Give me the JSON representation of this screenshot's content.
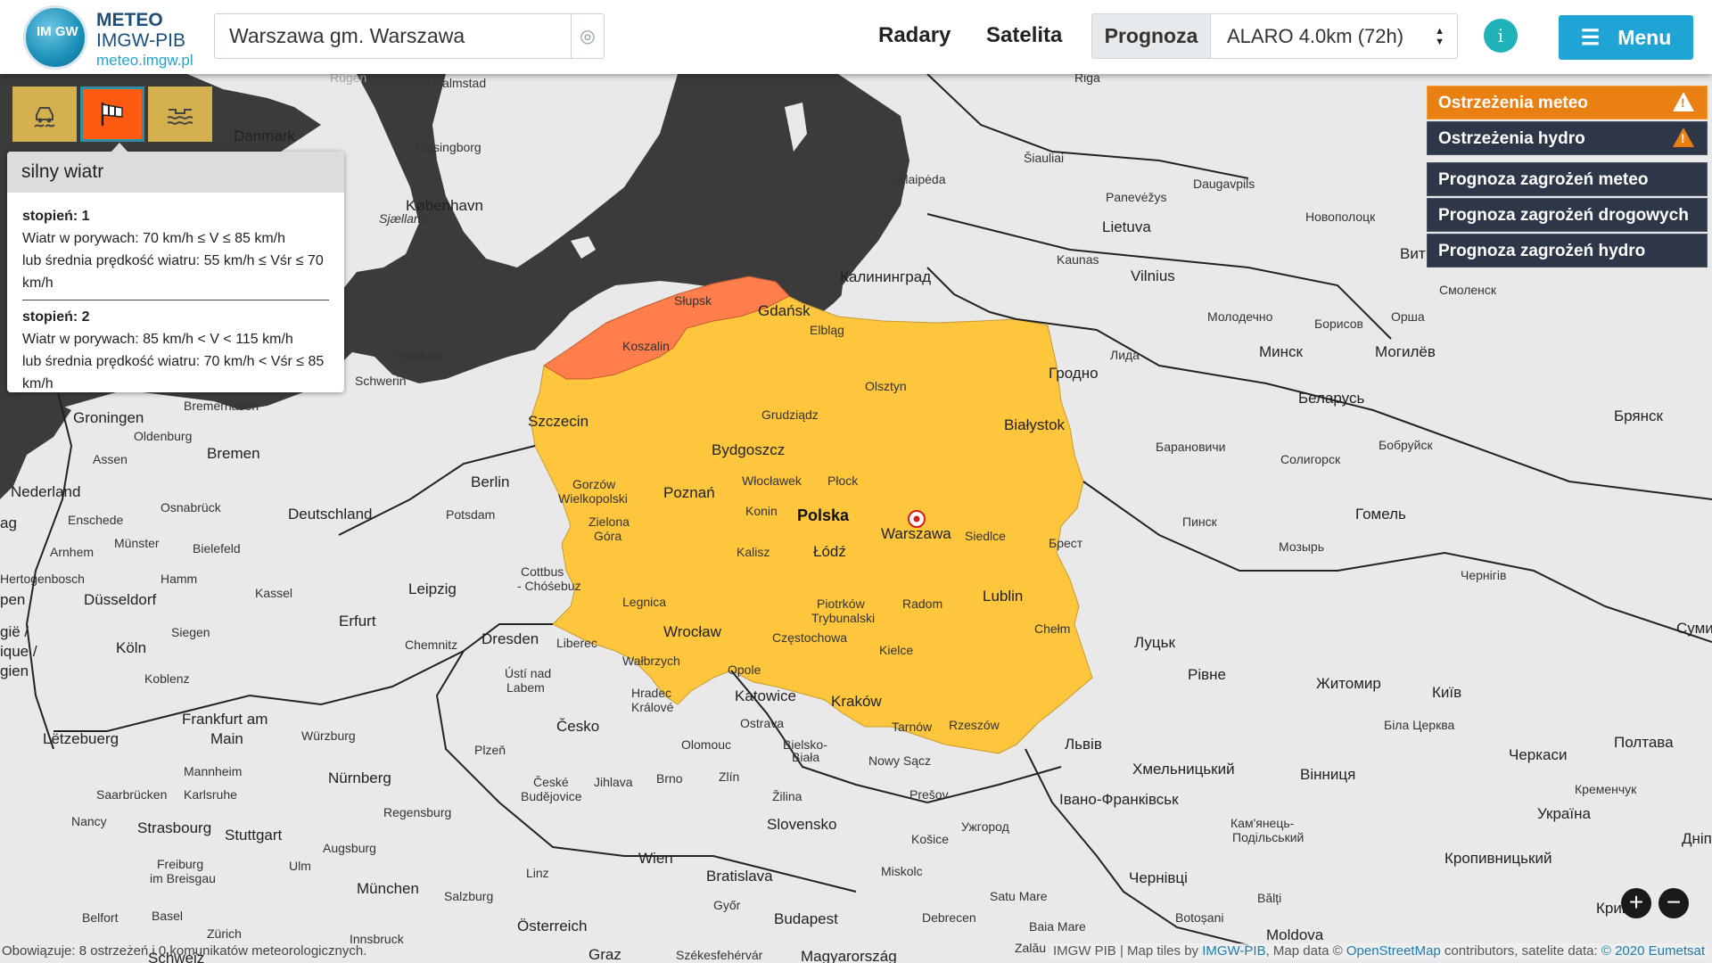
{
  "brand": {
    "logo_text": "IM GW",
    "line1": "METEO",
    "line2": "IMGW-PIB",
    "line3": "meteo.imgw.pl"
  },
  "search": {
    "value": "Warszawa gm. Warszawa"
  },
  "nav": {
    "radary": "Radary",
    "satelita": "Satelita",
    "prognoza": "Prognoza",
    "model": "ALARO 4.0km (72h)",
    "info": "i",
    "menu": "Menu"
  },
  "popup": {
    "title": "silny wiatr",
    "level1_title": "stopień: 1",
    "level1_line1": "Wiatr w porywach: 70 km/h ≤ V ≤ 85 km/h",
    "level1_line2": "lub średnia prędkość wiatru: 55 km/h ≤ Vśr ≤ 70 km/h",
    "level2_title": "stopień: 2",
    "level2_line1": "Wiatr w porywach: 85 km/h < V < 115 km/h",
    "level2_line2": "lub średnia prędkość wiatru: 70 km/h < Vśr ≤ 85 km/h"
  },
  "warning_tabs": [
    {
      "icon": "slippery-road-icon",
      "active": false
    },
    {
      "icon": "windsock-icon",
      "active": true
    },
    {
      "icon": "flood-icon",
      "active": false
    }
  ],
  "right_panel": {
    "items": [
      "Ostrzeżenia meteo",
      "Ostrzeżenia hydro",
      "Prognoza zagrożeń meteo",
      "Prognoza zagrożeń drogowych",
      "Prognoza zagrożeń hydro"
    ]
  },
  "zoom": {
    "in": "+",
    "out": "−"
  },
  "footer": {
    "status": "Obowiązuje: 8 ostrzeżeń i 0 komunikatów meteorologicznych.",
    "attribution_prefix": "IMGW PIB | Map tiles by ",
    "attribution_imgw": "IMGW-PIB",
    "attribution_mid": ", Map data © ",
    "attribution_osm": "OpenStreetMap",
    "attribution_mid2": " contributors, satelite data: ",
    "attribution_eumetsat": "© 2020 Eumetsat"
  },
  "colors": {
    "warning_level1": "#fec63d",
    "warning_level2": "#ff7e4b",
    "sea": "#3b3b3b",
    "land": "#e9e9e9",
    "accent": "#1fa4d6"
  },
  "map": {
    "places": {
      "riga": "Riga",
      "halmstad": "Halmstad",
      "danmark": "Danmark",
      "helsingborg": "Helsingborg",
      "kobenhavn": "København",
      "sjaelland": "Sjælland",
      "siauliai": "Šiauliai",
      "klaipeda": "Klaipėda",
      "panevezys": "Panevėžys",
      "daugavpils": "Daugavpils",
      "novopolotsk": "Новополоцк",
      "vit": "Вит",
      "lietuva": "Lietuva",
      "kaunas": "Kaunas",
      "vilnius": "Vilnius",
      "kaliningrad": "Калининград",
      "gdansk": "Gdańsk",
      "slupsk": "Słupsk",
      "koszalin": "Koszalin",
      "elblag": "Elbląg",
      "rostock": "Rostock",
      "schwerin": "Schwerin",
      "olsztyn": "Olsztyn",
      "grodno": "Гродно",
      "lida": "Лида",
      "molodechno": "Молодечно",
      "borisov": "Борисов",
      "minsk": "Минск",
      "mogilev": "Могилёв",
      "orsha": "Орша",
      "smolensk": "Смоленск",
      "szczecin": "Szczecin",
      "groningen": "Groningen",
      "bremerhaven": "Bremerhaven",
      "oldenburg": "Oldenburg",
      "bremen": "Bremen",
      "assen": "Assen",
      "nederland": "Nederland",
      "grudziadz": "Grudziądz",
      "bialystok": "Białystok",
      "belarus": "Беларусь",
      "bryansk": "Брянск",
      "bydgoszcz": "Bydgoszcz",
      "baranovichi": "Барановичи",
      "soligorsk": "Солигорск",
      "bobruisk": "Бобруйск",
      "berlin": "Berlin",
      "potsdam": "Potsdam",
      "gorzow1": "Gorzów",
      "gorzow2": "Wielkopolski",
      "poznan": "Poznań",
      "wloclawek": "Włocławek",
      "plock": "Płock",
      "osnabruck": "Osnabrück",
      "deutschland": "Deutschland",
      "konin": "Konin",
      "polska": "Polska",
      "warszawa": "Warszawa",
      "siedlce": "Siedlce",
      "brest": "Брест",
      "pinsk": "Пинск",
      "gomel": "Гомель",
      "mozyr": "Мозырь",
      "enschede": "Enschede",
      "ag": "ag",
      "zielona1": "Zielona",
      "zielona2": "Góra",
      "kalisz": "Kalisz",
      "lodz": "Łódź",
      "munster": "Münster",
      "bielefeld": "Bielefeld",
      "arnhem": "Arnhem",
      "hertogenbosch": "Hertogenbosch",
      "hamm": "Hamm",
      "cottbus1": "Cottbus",
      "cottbus2": "- Chóśebuz",
      "chernihiv": "Чернігів",
      "pen": "pen",
      "dusseldorf": "Düsseldorf",
      "kassel": "Kassel",
      "leipzig": "Leipzig",
      "legnica": "Legnica",
      "piotrkow1": "Piotrków",
      "piotrkow2": "Trybunalski",
      "radom": "Radom",
      "lublin": "Lublin",
      "sumy": "Суми",
      "erfurt": "Erfurt",
      "chelm": "Chełm",
      "belgie1": "gië /",
      "belgie2": "ique /",
      "belgie3": "gien",
      "koln": "Köln",
      "siegen": "Siegen",
      "dresden": "Dresden",
      "liberec": "Liberec",
      "wroclaw": "Wrocław",
      "czestochowa": "Częstochowa",
      "kielce": "Kielce",
      "lutsk": "Луцьк",
      "chemnitz": "Chemnitz",
      "walbrzych": "Wałbrzych",
      "opole": "Opole",
      "rivne": "Рівне",
      "zhytomyr": "Житомир",
      "kyiv": "Київ",
      "koblenz": "Koblenz",
      "usti1": "Ústí nad",
      "usti2": "Labem",
      "hradec1": "Hradec",
      "hradec2": "Králové",
      "katowice": "Katowice",
      "krakow": "Kraków",
      "frankfurt1": "Frankfurt am",
      "frankfurt2": "Main",
      "ostrava": "Ostrava",
      "tarnow": "Tarnów",
      "rzeszow": "Rzeszów",
      "cesko": "Česko",
      "bila": "Біла Церква",
      "letzebuerg": "Lëtzebuerg",
      "wurzburg": "Würzburg",
      "olomouc": "Olomouc",
      "bielsko1": "Bielsko-",
      "bielsko2": "Biała",
      "lviv": "Львів",
      "poltava": "Полтава",
      "plzen": "Plzeň",
      "novysacz": "Nowy Sącz",
      "cherkasy": "Черкаси",
      "mannheim": "Mannheim",
      "nurnberg": "Nürnberg",
      "khmelnytskyi": "Хмельницький",
      "vinnytsia": "Вінниця",
      "zlin": "Zlín",
      "ceske1": "České",
      "ceske2": "Budějovice",
      "jihlava": "Jihlava",
      "brno": "Brno",
      "saarbrucken": "Saarbrücken",
      "karlsruhe": "Karlsruhe",
      "zilina": "Žilina",
      "presov": "Prešov",
      "kremenchuk": "Кременчук",
      "ivano": "Івано-Франківськ",
      "regensburg": "Regensburg",
      "nancy": "Nancy",
      "slovensko": "Slovensko",
      "ukraina": "Україна",
      "strasbourg": "Strasbourg",
      "stuttgart": "Stuttgart",
      "uzhgorod": "Ужгород",
      "kosice": "Košice",
      "kamianets1": "Кам'янець-",
      "kamianets2": "Подільський",
      "augsburg": "Augsburg",
      "wien": "Wien",
      "kropyvnytskyi": "Кропивницький",
      "dnipr": "Дніпр",
      "freiburg1": "Freiburg",
      "freiburg2": "im Breisgau",
      "ulm": "Ulm",
      "bratislava": "Bratislava",
      "miskolc": "Miskolc",
      "linz": "Linz",
      "munchen": "München",
      "chernivtsi": "Чернівці",
      "salzburg": "Salzburg",
      "satumare": "Satu Mare",
      "balti": "Bălți",
      "gyor": "Győr",
      "belfort": "Belfort",
      "basel": "Basel",
      "budapest": "Budapest",
      "debrecen": "Debrecen",
      "baiamare": "Baia Mare",
      "botosani": "Botoșani",
      "kryvyi": "Кривий",
      "zurich": "Zürich",
      "osterreich": "Österreich",
      "innsbruck": "Innsbruck",
      "graz": "Graz",
      "szekesfehervar": "Székesfehérvár",
      "magyarorszag": "Magyarország",
      "zalau": "Zalău",
      "moldova": "Moldova",
      "schweiz": "Schweiz",
      "rugen": "Rügen"
    }
  }
}
